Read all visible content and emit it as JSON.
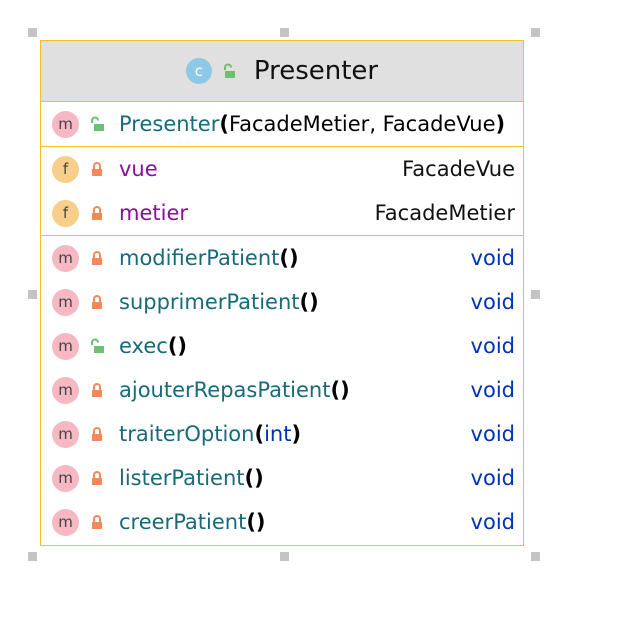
{
  "class": {
    "kind_letter": "c",
    "name": "Presenter"
  },
  "constructors": [
    {
      "letter": "m",
      "name": "Presenter",
      "open": "(",
      "params": "FacadeMetier, FacadeVue",
      "close": ")",
      "visibility": "public"
    }
  ],
  "fields": [
    {
      "letter": "f",
      "name": "vue",
      "type": "FacadeVue",
      "visibility": "private"
    },
    {
      "letter": "f",
      "name": "metier",
      "type": "FacadeMetier",
      "visibility": "private"
    }
  ],
  "methods": [
    {
      "letter": "m",
      "name": "modifierPatient",
      "parens": "()",
      "return": "void",
      "visibility": "private"
    },
    {
      "letter": "m",
      "name": "supprimerPatient",
      "parens": "()",
      "return": "void",
      "visibility": "private"
    },
    {
      "letter": "m",
      "name": "exec",
      "parens": "()",
      "return": "void",
      "visibility": "public"
    },
    {
      "letter": "m",
      "name": "ajouterRepasPatient",
      "parens": "()",
      "return": "void",
      "visibility": "private"
    },
    {
      "letter": "m",
      "name": "traiterOption",
      "open": "(",
      "param": "int",
      "close": ")",
      "return": "void",
      "visibility": "private"
    },
    {
      "letter": "m",
      "name": "listerPatient",
      "parens": "()",
      "return": "void",
      "visibility": "private"
    },
    {
      "letter": "m",
      "name": "creerPatient",
      "parens": "()",
      "return": "void",
      "visibility": "private"
    }
  ],
  "colors": {
    "border": "#f2c21b",
    "header_bg": "#e0e0e0",
    "method_name": "#176a7a",
    "field_name": "#871094",
    "keyword_type": "#0033b3",
    "lock_private": "#ef8a5a",
    "lock_public": "#6fbf73"
  },
  "icons": {
    "class": "class-icon",
    "method": "method-icon",
    "field": "field-icon",
    "private": "lock-closed-icon",
    "public": "lock-open-icon"
  }
}
